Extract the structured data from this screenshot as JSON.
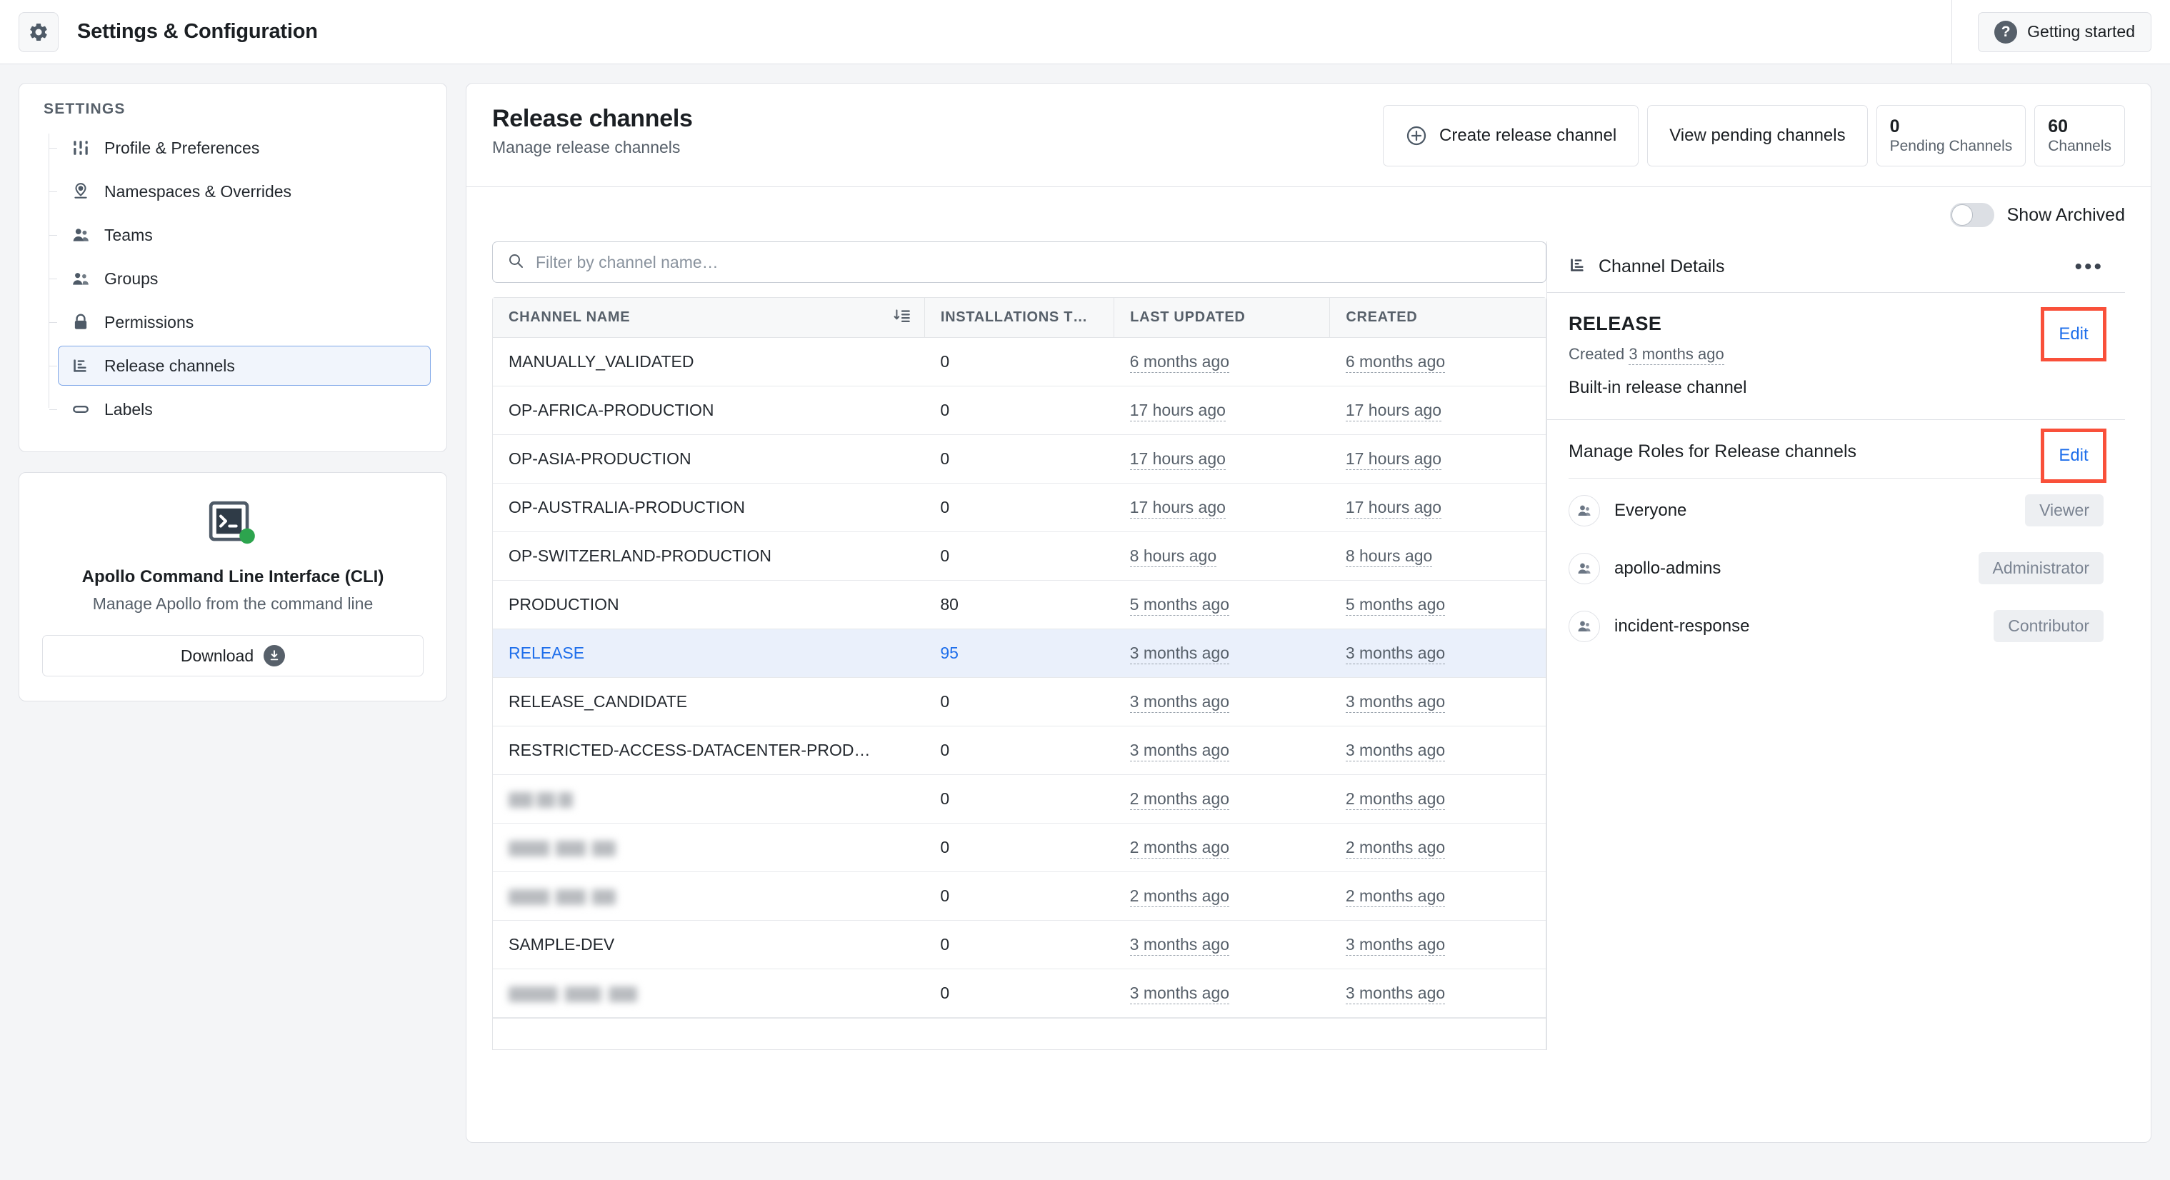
{
  "topbar": {
    "gear_icon": "gear-icon",
    "title": "Settings & Configuration",
    "getting_started_label": "Getting started",
    "help_glyph": "?"
  },
  "sidebar": {
    "section_label": "SETTINGS",
    "items": [
      {
        "label": "Profile & Preferences",
        "icon": "sliders-icon",
        "active": false
      },
      {
        "label": "Namespaces & Overrides",
        "icon": "map-pin-user-icon",
        "active": false
      },
      {
        "label": "Teams",
        "icon": "users-icon",
        "active": false
      },
      {
        "label": "Groups",
        "icon": "group-people-icon",
        "active": false
      },
      {
        "label": "Permissions",
        "icon": "lock-icon",
        "active": false
      },
      {
        "label": "Release channels",
        "icon": "release-channel-icon",
        "active": true
      },
      {
        "label": "Labels",
        "icon": "tag-pill-icon",
        "active": false
      }
    ],
    "cli_card": {
      "icon": "terminal-icon",
      "status_dot_color": "#2da44e",
      "title": "Apollo Command Line Interface (CLI)",
      "subtitle": "Manage Apollo from the command line",
      "download_label": "Download",
      "download_icon": "download-arrow-icon"
    }
  },
  "main": {
    "title": "Release channels",
    "subtitle": "Manage release channels",
    "create_button": "Create release channel",
    "create_icon": "plus-circle-icon",
    "view_pending_button": "View pending channels",
    "stats": [
      {
        "value": "0",
        "label": "Pending Channels"
      },
      {
        "value": "60",
        "label": "Channels"
      }
    ],
    "show_archived_label": "Show Archived",
    "show_archived_on": false,
    "search": {
      "placeholder": "Filter by channel name…",
      "value": "",
      "icon": "search-icon"
    },
    "table": {
      "columns": [
        "CHANNEL NAME",
        "INSTALLATIONS TRAC…",
        "LAST UPDATED",
        "CREATED"
      ],
      "sort_icon": "sort-descending-icon",
      "rows": [
        {
          "name": "MANUALLY_VALIDATED",
          "redacted": false,
          "installations": "0",
          "last_updated": "6 months ago",
          "created": "6 months ago",
          "selected": false
        },
        {
          "name": "OP-AFRICA-PRODUCTION",
          "redacted": false,
          "installations": "0",
          "last_updated": "17 hours ago",
          "created": "17 hours ago",
          "selected": false
        },
        {
          "name": "OP-ASIA-PRODUCTION",
          "redacted": false,
          "installations": "0",
          "last_updated": "17 hours ago",
          "created": "17 hours ago",
          "selected": false
        },
        {
          "name": "OP-AUSTRALIA-PRODUCTION",
          "redacted": false,
          "installations": "0",
          "last_updated": "17 hours ago",
          "created": "17 hours ago",
          "selected": false
        },
        {
          "name": "OP-SWITZERLAND-PRODUCTION",
          "redacted": false,
          "installations": "0",
          "last_updated": "8 hours ago",
          "created": "8 hours ago",
          "selected": false
        },
        {
          "name": "PRODUCTION",
          "redacted": false,
          "installations": "80",
          "last_updated": "5 months ago",
          "created": "5 months ago",
          "selected": false
        },
        {
          "name": "RELEASE",
          "redacted": false,
          "installations": "95",
          "last_updated": "3 months ago",
          "created": "3 months ago",
          "selected": true
        },
        {
          "name": "RELEASE_CANDIDATE",
          "redacted": false,
          "installations": "0",
          "last_updated": "3 months ago",
          "created": "3 months ago",
          "selected": false
        },
        {
          "name": "RESTRICTED-ACCESS-DATACENTER-PROD…",
          "redacted": false,
          "installations": "0",
          "last_updated": "3 months ago",
          "created": "3 months ago",
          "selected": false
        },
        {
          "name": "",
          "redacted": true,
          "redacted_width": 90,
          "installations": "0",
          "last_updated": "2 months ago",
          "created": "2 months ago",
          "selected": false
        },
        {
          "name": "",
          "redacted": true,
          "redacted_width": 150,
          "installations": "0",
          "last_updated": "2 months ago",
          "created": "2 months ago",
          "selected": false
        },
        {
          "name": "",
          "redacted": true,
          "redacted_width": 150,
          "installations": "0",
          "last_updated": "2 months ago",
          "created": "2 months ago",
          "selected": false
        },
        {
          "name": "SAMPLE-DEV",
          "redacted": false,
          "installations": "0",
          "last_updated": "3 months ago",
          "created": "3 months ago",
          "selected": false
        },
        {
          "name": "",
          "redacted": true,
          "redacted_width": 180,
          "installations": "0",
          "last_updated": "3 months ago",
          "created": "3 months ago",
          "selected": false
        }
      ]
    },
    "details": {
      "panel_icon": "release-channel-icon",
      "panel_title": "Channel Details",
      "overflow_icon": "ellipsis-icon",
      "channel_name": "RELEASE",
      "created_prefix": "Created ",
      "created_value": "3 months ago",
      "description": "Built-in release channel",
      "edit_label": "Edit",
      "highlight_color": "#f9503a"
    },
    "roles": {
      "title": "Manage Roles for Release channels",
      "edit_label": "Edit",
      "entries": [
        {
          "name": "Everyone",
          "role": "Viewer",
          "avatar": "people-avatar-icon"
        },
        {
          "name": "apollo-admins",
          "role": "Administrator",
          "avatar": "people-avatar-icon"
        },
        {
          "name": "incident-response",
          "role": "Contributor",
          "avatar": "people-avatar-icon"
        }
      ]
    }
  }
}
